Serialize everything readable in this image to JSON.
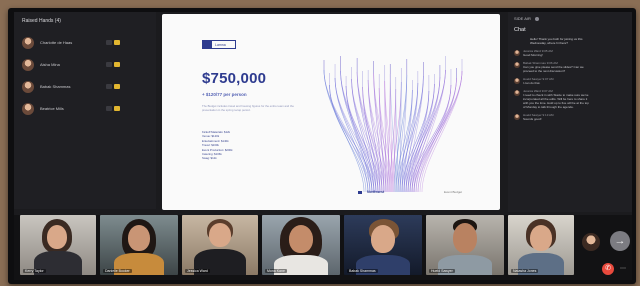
{
  "participants_panel": {
    "title": "Raised Hands (4)",
    "people": [
      {
        "name": "Charlotte de Haas"
      },
      {
        "name": "Aisha Mina"
      },
      {
        "name": "Babak Shammas"
      },
      {
        "name": "Beatrice Mills"
      }
    ]
  },
  "slide": {
    "logo_text": "Lamna",
    "amount": "$750,000",
    "subline": "+ $120/77 per person",
    "description": "The Budget includes travel and housing figures for the entire team and the presentation in the spring recap period.",
    "list": [
      "Kickoff Materials: $12k",
      "Venue: $120k",
      "Entertainment: $140k",
      "Travel: $160k",
      "Event Production: $200k",
      "Catering: $106k",
      "Swag: $12k"
    ],
    "footer_brand": "Northwest",
    "footer_right": "Event Budget"
  },
  "chat_panel": {
    "top_label": "SIDE AIR",
    "title": "Chat",
    "messages": [
      {
        "sender": "",
        "time": "",
        "text": "Hello! Thank you both for joining us this Wednesday, where hi there?",
        "own": true
      },
      {
        "sender": "Jessica Ward",
        "time": "9:05 AM",
        "text": "Good Morning!",
        "own": false
      },
      {
        "sender": "Babak Shammas",
        "time": "9:06 AM",
        "text": "Can you give please send the slides? Can we proceed to the next discussion?",
        "own": false
      },
      {
        "sender": "Hueld Sawyer",
        "time": "9:07 AM",
        "text": "I can do that.",
        "own": false
      },
      {
        "sender": "Jessica Ward",
        "time": "9:07 AM",
        "text": "I need to check in with Stacie to make sure we've incorporated all the edits. Will be here to share it with you the time. Hold up to five will be at the top of Monday to talk through the agenda.",
        "own": false
      },
      {
        "sender": "Hueld Sawyer",
        "time": "9:13 AM",
        "text": "Sounds good!",
        "own": false
      }
    ]
  },
  "video_strip": {
    "tiles": [
      {
        "name": "Kerry Taylor"
      },
      {
        "name": "Danielle Booker"
      },
      {
        "name": "Jessica Ward"
      },
      {
        "name": "Mona Kane"
      },
      {
        "name": "Babak Shammas"
      },
      {
        "name": "Hueld Sawyer"
      },
      {
        "name": "Natasha Jones"
      }
    ],
    "next_icon": "→",
    "leave_icon": "✆",
    "more_icon": "⋯"
  },
  "colors": {
    "accent": "#2e3b8f",
    "camera_on": "#e2b630",
    "leave": "#e94a3d"
  }
}
